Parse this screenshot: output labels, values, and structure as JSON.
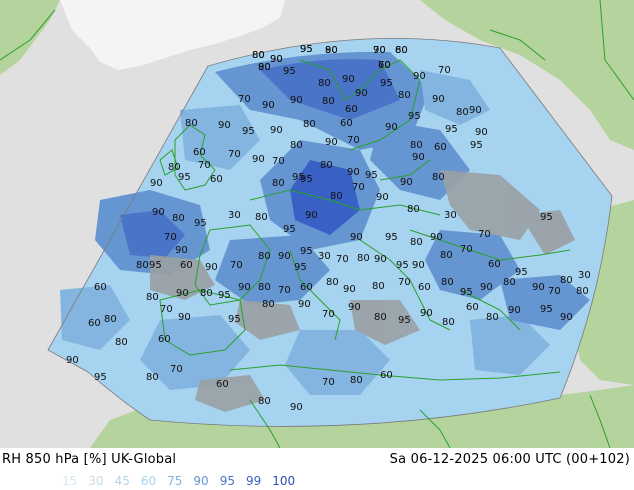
{
  "product": {
    "left_label": "RH 850 hPa [%] UK-Global",
    "right_label": "Sa 06-12-2025 06:00 UTC (00+102)"
  },
  "legend": {
    "items": [
      {
        "label": "15",
        "color": "#d6e6ee"
      },
      {
        "label": "30",
        "color": "#c7dcea"
      },
      {
        "label": "45",
        "color": "#b7d2e6"
      },
      {
        "label": "60",
        "color": "#a6d3ef"
      },
      {
        "label": "75",
        "color": "#83b5e0"
      },
      {
        "label": "90",
        "color": "#6596d2"
      },
      {
        "label": "95",
        "color": "#4a74c8"
      },
      {
        "label": "99",
        "color": "#3960c4"
      },
      {
        "label": "100",
        "color": "#2c4fb8"
      }
    ]
  },
  "colors": {
    "land": "#b5d39c",
    "sea": "#e0e0e0",
    "greenland": "#f4f4f4",
    "dry_grey": "#9aa0a4",
    "borders": "#2aa02a"
  },
  "contour_labels": [
    {
      "t": "80"
    },
    {
      "t": "90"
    },
    {
      "t": "95"
    },
    {
      "t": "90"
    },
    {
      "t": "70"
    },
    {
      "t": "60"
    },
    {
      "t": "80"
    },
    {
      "t": "90"
    },
    {
      "t": "95"
    },
    {
      "t": "80"
    },
    {
      "t": "90"
    },
    {
      "t": "90"
    },
    {
      "t": "95"
    },
    {
      "t": "80"
    },
    {
      "t": "70"
    },
    {
      "t": "90"
    },
    {
      "t": "90"
    },
    {
      "t": "80"
    },
    {
      "t": "60"
    },
    {
      "t": "90"
    },
    {
      "t": "70"
    },
    {
      "t": "90"
    },
    {
      "t": "80"
    },
    {
      "t": "90"
    },
    {
      "t": "95"
    },
    {
      "t": "90"
    },
    {
      "t": "60"
    },
    {
      "t": "80"
    },
    {
      "t": "90"
    },
    {
      "t": "95"
    },
    {
      "t": "80"
    },
    {
      "t": "90"
    },
    {
      "t": "80"
    },
    {
      "t": "90"
    },
    {
      "t": "70"
    },
    {
      "t": "80"
    },
    {
      "t": "60"
    },
    {
      "t": "95"
    },
    {
      "t": "90"
    },
    {
      "t": "95"
    },
    {
      "t": "70"
    },
    {
      "t": "90"
    },
    {
      "t": "70"
    },
    {
      "t": "95"
    },
    {
      "t": "80"
    },
    {
      "t": "90"
    },
    {
      "t": "95"
    },
    {
      "t": "90"
    },
    {
      "t": "80"
    },
    {
      "t": "90"
    },
    {
      "t": "80"
    },
    {
      "t": "60"
    },
    {
      "t": "70"
    },
    {
      "t": "90"
    },
    {
      "t": "95"
    },
    {
      "t": "60"
    },
    {
      "t": "80"
    },
    {
      "t": "95"
    },
    {
      "t": "80"
    },
    {
      "t": "70"
    },
    {
      "t": "90"
    },
    {
      "t": "80"
    },
    {
      "t": "30"
    },
    {
      "t": "95"
    },
    {
      "t": "70"
    },
    {
      "t": "90"
    },
    {
      "t": "80"
    },
    {
      "t": "95"
    },
    {
      "t": "90"
    },
    {
      "t": "90"
    },
    {
      "t": "95"
    },
    {
      "t": "80"
    },
    {
      "t": "30"
    },
    {
      "t": "90"
    },
    {
      "t": "80"
    },
    {
      "t": "95"
    },
    {
      "t": "70"
    },
    {
      "t": "90"
    },
    {
      "t": "80"
    },
    {
      "t": "95"
    },
    {
      "t": "60"
    },
    {
      "t": "90"
    },
    {
      "t": "70"
    },
    {
      "t": "80"
    },
    {
      "t": "90"
    },
    {
      "t": "95"
    },
    {
      "t": "95"
    },
    {
      "t": "30"
    },
    {
      "t": "70"
    },
    {
      "t": "80"
    },
    {
      "t": "90"
    },
    {
      "t": "95"
    },
    {
      "t": "90"
    },
    {
      "t": "80"
    },
    {
      "t": "70"
    },
    {
      "t": "60"
    },
    {
      "t": "95"
    },
    {
      "t": "80"
    },
    {
      "t": "90"
    },
    {
      "t": "95"
    },
    {
      "t": "80"
    },
    {
      "t": "60"
    },
    {
      "t": "70"
    },
    {
      "t": "80"
    },
    {
      "t": "90"
    },
    {
      "t": "80"
    },
    {
      "t": "60"
    },
    {
      "t": "70"
    },
    {
      "t": "80"
    },
    {
      "t": "90"
    },
    {
      "t": "95"
    },
    {
      "t": "80"
    },
    {
      "t": "90"
    },
    {
      "t": "80"
    },
    {
      "t": "60"
    },
    {
      "t": "80"
    },
    {
      "t": "60"
    },
    {
      "t": "70"
    },
    {
      "t": "90"
    },
    {
      "t": "95"
    },
    {
      "t": "80"
    },
    {
      "t": "90"
    },
    {
      "t": "70"
    },
    {
      "t": "90"
    },
    {
      "t": "80"
    },
    {
      "t": "95"
    },
    {
      "t": "90"
    },
    {
      "t": "80"
    },
    {
      "t": "60"
    },
    {
      "t": "80"
    },
    {
      "t": "90"
    },
    {
      "t": "95"
    },
    {
      "t": "90"
    },
    {
      "t": "80"
    },
    {
      "t": "70"
    },
    {
      "t": "90"
    },
    {
      "t": "80"
    },
    {
      "t": "30"
    },
    {
      "t": "60"
    },
    {
      "t": "80"
    },
    {
      "t": "90"
    },
    {
      "t": "95"
    },
    {
      "t": "80"
    },
    {
      "t": "70"
    },
    {
      "t": "60"
    },
    {
      "t": "80"
    },
    {
      "t": "90"
    },
    {
      "t": "70"
    },
    {
      "t": "80"
    },
    {
      "t": "60"
    },
    {
      "t": "80"
    },
    {
      "t": "90"
    },
    {
      "t": "95"
    },
    {
      "t": "80"
    },
    {
      "t": "90"
    },
    {
      "t": "70"
    },
    {
      "t": "60"
    },
    {
      "t": "80"
    }
  ]
}
